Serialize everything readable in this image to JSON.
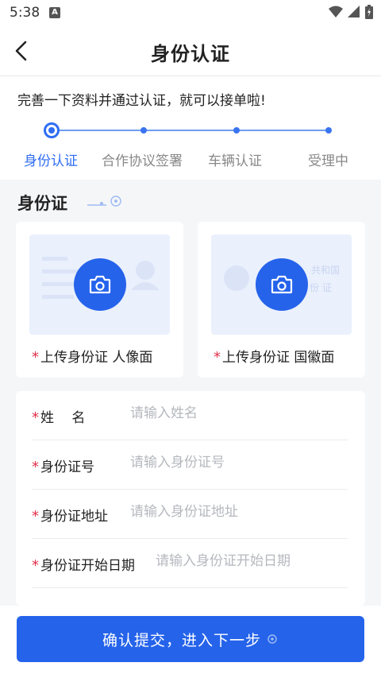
{
  "status_bar": {
    "time": "5:38",
    "notification_badge": "A"
  },
  "nav": {
    "title": "身份认证",
    "back_icon": "chevron-left-icon"
  },
  "intro": {
    "text": "完善一下资料并通过认证，就可以接单啦!"
  },
  "steps": [
    {
      "label": "身份认证",
      "active": true
    },
    {
      "label": "合作协议签署",
      "active": false
    },
    {
      "label": "车辆认证",
      "active": false
    },
    {
      "label": "受理中",
      "active": false
    }
  ],
  "section": {
    "title": "身份证"
  },
  "uploads": [
    {
      "label": "上传身份证 人像面",
      "required_mark": "*"
    },
    {
      "label": "上传身份证 国徽面",
      "required_mark": "*",
      "emblem_text_1": "共和国",
      "emblem_text_2": "份 证"
    }
  ],
  "form": {
    "fields": [
      {
        "label": "姓　 名",
        "placeholder": "请输入姓名",
        "required_mark": "*"
      },
      {
        "label": "身份证号",
        "placeholder": "请输入身份证号",
        "required_mark": "*"
      },
      {
        "label": "身份证地址",
        "placeholder": "请输入身份证地址",
        "required_mark": "*"
      },
      {
        "label": "身份证开始日期",
        "placeholder": "请输入身份证开始日期",
        "required_mark": "*"
      }
    ]
  },
  "submit": {
    "label": "确认提交，进入下一步"
  },
  "colors": {
    "primary": "#2563eb",
    "required": "#e0314b",
    "step_line": "#6f9df0"
  }
}
